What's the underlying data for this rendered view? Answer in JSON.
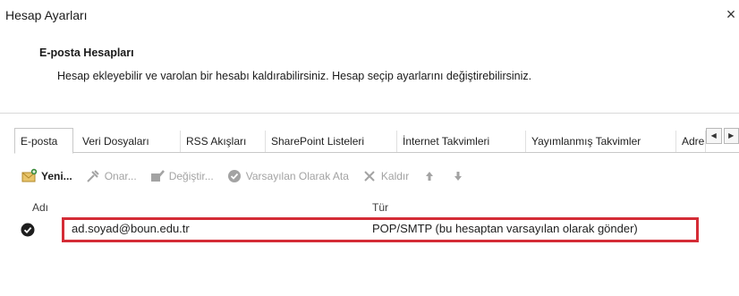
{
  "window": {
    "title": "Hesap Ayarları",
    "close_glyph": "×"
  },
  "header": {
    "section_title": "E-posta Hesapları",
    "description": "Hesap ekleyebilir ve varolan bir hesabı kaldırabilirsiniz. Hesap seçip ayarlarını değiştirebilirsiniz."
  },
  "tabs": [
    {
      "label": "E-posta",
      "active": true
    },
    {
      "label": "Veri Dosyaları"
    },
    {
      "label": "RSS Akışları"
    },
    {
      "label": "SharePoint Listeleri"
    },
    {
      "label": "İnternet Takvimleri"
    },
    {
      "label": "Yayımlanmış Takvimler"
    },
    {
      "label": "Adres Defterleri"
    }
  ],
  "tab_scroll": {
    "left": "◀",
    "right": "▶"
  },
  "toolbar": {
    "new": {
      "label": "Yeni...",
      "icon": "new-account-icon"
    },
    "repair": {
      "label": "Onar...",
      "icon": "repair-icon",
      "disabled": true
    },
    "change": {
      "label": "Değiştir...",
      "icon": "change-icon",
      "disabled": true
    },
    "set_default": {
      "label": "Varsayılan Olarak Ata",
      "icon": "checkmark-circle-icon",
      "disabled": true
    },
    "remove": {
      "label": "Kaldır",
      "icon": "remove-x-icon",
      "disabled": true
    },
    "move_up": {
      "icon": "arrow-up-icon",
      "disabled": true
    },
    "move_down": {
      "icon": "arrow-down-icon",
      "disabled": true
    }
  },
  "list": {
    "columns": {
      "name": "Adı",
      "type": "Tür"
    },
    "rows": [
      {
        "name": "ad.soyad@boun.edu.tr",
        "type": "POP/SMTP (bu hesaptan varsayılan olarak gönder)",
        "default": true,
        "highlighted": true
      }
    ]
  },
  "colors": {
    "highlight": "#d42c36",
    "disabled_text": "#a3a3a3",
    "tab_border": "#c8c8c8"
  }
}
